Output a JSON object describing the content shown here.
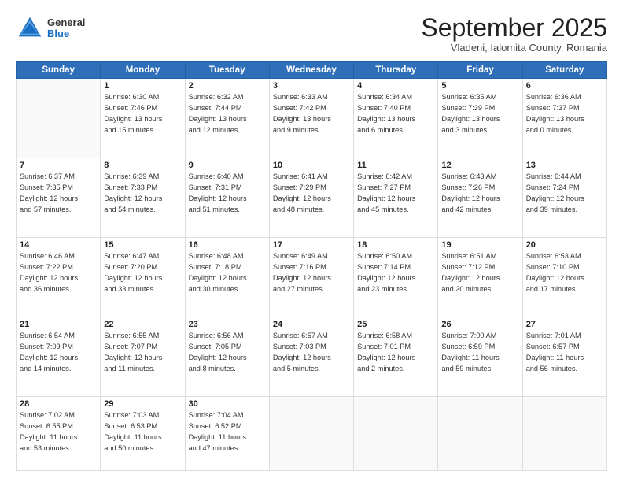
{
  "logo": {
    "general": "General",
    "blue": "Blue"
  },
  "header": {
    "month_title": "September 2025",
    "subtitle": "Vladeni, Ialomita County, Romania"
  },
  "weekdays": [
    "Sunday",
    "Monday",
    "Tuesday",
    "Wednesday",
    "Thursday",
    "Friday",
    "Saturday"
  ],
  "days": [
    {
      "num": "",
      "info": ""
    },
    {
      "num": "1",
      "info": "Sunrise: 6:30 AM\nSunset: 7:46 PM\nDaylight: 13 hours\nand 15 minutes."
    },
    {
      "num": "2",
      "info": "Sunrise: 6:32 AM\nSunset: 7:44 PM\nDaylight: 13 hours\nand 12 minutes."
    },
    {
      "num": "3",
      "info": "Sunrise: 6:33 AM\nSunset: 7:42 PM\nDaylight: 13 hours\nand 9 minutes."
    },
    {
      "num": "4",
      "info": "Sunrise: 6:34 AM\nSunset: 7:40 PM\nDaylight: 13 hours\nand 6 minutes."
    },
    {
      "num": "5",
      "info": "Sunrise: 6:35 AM\nSunset: 7:39 PM\nDaylight: 13 hours\nand 3 minutes."
    },
    {
      "num": "6",
      "info": "Sunrise: 6:36 AM\nSunset: 7:37 PM\nDaylight: 13 hours\nand 0 minutes."
    },
    {
      "num": "7",
      "info": "Sunrise: 6:37 AM\nSunset: 7:35 PM\nDaylight: 12 hours\nand 57 minutes."
    },
    {
      "num": "8",
      "info": "Sunrise: 6:39 AM\nSunset: 7:33 PM\nDaylight: 12 hours\nand 54 minutes."
    },
    {
      "num": "9",
      "info": "Sunrise: 6:40 AM\nSunset: 7:31 PM\nDaylight: 12 hours\nand 51 minutes."
    },
    {
      "num": "10",
      "info": "Sunrise: 6:41 AM\nSunset: 7:29 PM\nDaylight: 12 hours\nand 48 minutes."
    },
    {
      "num": "11",
      "info": "Sunrise: 6:42 AM\nSunset: 7:27 PM\nDaylight: 12 hours\nand 45 minutes."
    },
    {
      "num": "12",
      "info": "Sunrise: 6:43 AM\nSunset: 7:26 PM\nDaylight: 12 hours\nand 42 minutes."
    },
    {
      "num": "13",
      "info": "Sunrise: 6:44 AM\nSunset: 7:24 PM\nDaylight: 12 hours\nand 39 minutes."
    },
    {
      "num": "14",
      "info": "Sunrise: 6:46 AM\nSunset: 7:22 PM\nDaylight: 12 hours\nand 36 minutes."
    },
    {
      "num": "15",
      "info": "Sunrise: 6:47 AM\nSunset: 7:20 PM\nDaylight: 12 hours\nand 33 minutes."
    },
    {
      "num": "16",
      "info": "Sunrise: 6:48 AM\nSunset: 7:18 PM\nDaylight: 12 hours\nand 30 minutes."
    },
    {
      "num": "17",
      "info": "Sunrise: 6:49 AM\nSunset: 7:16 PM\nDaylight: 12 hours\nand 27 minutes."
    },
    {
      "num": "18",
      "info": "Sunrise: 6:50 AM\nSunset: 7:14 PM\nDaylight: 12 hours\nand 23 minutes."
    },
    {
      "num": "19",
      "info": "Sunrise: 6:51 AM\nSunset: 7:12 PM\nDaylight: 12 hours\nand 20 minutes."
    },
    {
      "num": "20",
      "info": "Sunrise: 6:53 AM\nSunset: 7:10 PM\nDaylight: 12 hours\nand 17 minutes."
    },
    {
      "num": "21",
      "info": "Sunrise: 6:54 AM\nSunset: 7:09 PM\nDaylight: 12 hours\nand 14 minutes."
    },
    {
      "num": "22",
      "info": "Sunrise: 6:55 AM\nSunset: 7:07 PM\nDaylight: 12 hours\nand 11 minutes."
    },
    {
      "num": "23",
      "info": "Sunrise: 6:56 AM\nSunset: 7:05 PM\nDaylight: 12 hours\nand 8 minutes."
    },
    {
      "num": "24",
      "info": "Sunrise: 6:57 AM\nSunset: 7:03 PM\nDaylight: 12 hours\nand 5 minutes."
    },
    {
      "num": "25",
      "info": "Sunrise: 6:58 AM\nSunset: 7:01 PM\nDaylight: 12 hours\nand 2 minutes."
    },
    {
      "num": "26",
      "info": "Sunrise: 7:00 AM\nSunset: 6:59 PM\nDaylight: 11 hours\nand 59 minutes."
    },
    {
      "num": "27",
      "info": "Sunrise: 7:01 AM\nSunset: 6:57 PM\nDaylight: 11 hours\nand 56 minutes."
    },
    {
      "num": "28",
      "info": "Sunrise: 7:02 AM\nSunset: 6:55 PM\nDaylight: 11 hours\nand 53 minutes."
    },
    {
      "num": "29",
      "info": "Sunrise: 7:03 AM\nSunset: 6:53 PM\nDaylight: 11 hours\nand 50 minutes."
    },
    {
      "num": "30",
      "info": "Sunrise: 7:04 AM\nSunset: 6:52 PM\nDaylight: 11 hours\nand 47 minutes."
    },
    {
      "num": "",
      "info": ""
    },
    {
      "num": "",
      "info": ""
    },
    {
      "num": "",
      "info": ""
    },
    {
      "num": "",
      "info": ""
    }
  ]
}
